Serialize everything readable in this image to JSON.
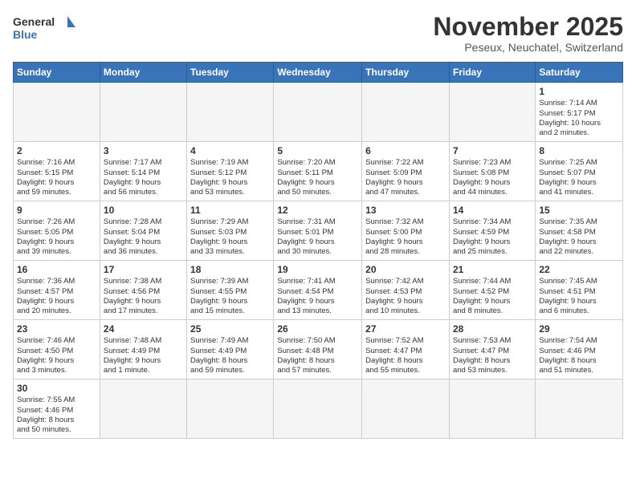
{
  "logo": {
    "text_general": "General",
    "text_blue": "Blue"
  },
  "header": {
    "month_title": "November 2025",
    "subtitle": "Peseux, Neuchatel, Switzerland"
  },
  "weekdays": [
    "Sunday",
    "Monday",
    "Tuesday",
    "Wednesday",
    "Thursday",
    "Friday",
    "Saturday"
  ],
  "weeks": [
    [
      {
        "day": "",
        "info": ""
      },
      {
        "day": "",
        "info": ""
      },
      {
        "day": "",
        "info": ""
      },
      {
        "day": "",
        "info": ""
      },
      {
        "day": "",
        "info": ""
      },
      {
        "day": "",
        "info": ""
      },
      {
        "day": "1",
        "info": "Sunrise: 7:14 AM\nSunset: 5:17 PM\nDaylight: 10 hours\nand 2 minutes."
      }
    ],
    [
      {
        "day": "2",
        "info": "Sunrise: 7:16 AM\nSunset: 5:15 PM\nDaylight: 9 hours\nand 59 minutes."
      },
      {
        "day": "3",
        "info": "Sunrise: 7:17 AM\nSunset: 5:14 PM\nDaylight: 9 hours\nand 56 minutes."
      },
      {
        "day": "4",
        "info": "Sunrise: 7:19 AM\nSunset: 5:12 PM\nDaylight: 9 hours\nand 53 minutes."
      },
      {
        "day": "5",
        "info": "Sunrise: 7:20 AM\nSunset: 5:11 PM\nDaylight: 9 hours\nand 50 minutes."
      },
      {
        "day": "6",
        "info": "Sunrise: 7:22 AM\nSunset: 5:09 PM\nDaylight: 9 hours\nand 47 minutes."
      },
      {
        "day": "7",
        "info": "Sunrise: 7:23 AM\nSunset: 5:08 PM\nDaylight: 9 hours\nand 44 minutes."
      },
      {
        "day": "8",
        "info": "Sunrise: 7:25 AM\nSunset: 5:07 PM\nDaylight: 9 hours\nand 41 minutes."
      }
    ],
    [
      {
        "day": "9",
        "info": "Sunrise: 7:26 AM\nSunset: 5:05 PM\nDaylight: 9 hours\nand 39 minutes."
      },
      {
        "day": "10",
        "info": "Sunrise: 7:28 AM\nSunset: 5:04 PM\nDaylight: 9 hours\nand 36 minutes."
      },
      {
        "day": "11",
        "info": "Sunrise: 7:29 AM\nSunset: 5:03 PM\nDaylight: 9 hours\nand 33 minutes."
      },
      {
        "day": "12",
        "info": "Sunrise: 7:31 AM\nSunset: 5:01 PM\nDaylight: 9 hours\nand 30 minutes."
      },
      {
        "day": "13",
        "info": "Sunrise: 7:32 AM\nSunset: 5:00 PM\nDaylight: 9 hours\nand 28 minutes."
      },
      {
        "day": "14",
        "info": "Sunrise: 7:34 AM\nSunset: 4:59 PM\nDaylight: 9 hours\nand 25 minutes."
      },
      {
        "day": "15",
        "info": "Sunrise: 7:35 AM\nSunset: 4:58 PM\nDaylight: 9 hours\nand 22 minutes."
      }
    ],
    [
      {
        "day": "16",
        "info": "Sunrise: 7:36 AM\nSunset: 4:57 PM\nDaylight: 9 hours\nand 20 minutes."
      },
      {
        "day": "17",
        "info": "Sunrise: 7:38 AM\nSunset: 4:56 PM\nDaylight: 9 hours\nand 17 minutes."
      },
      {
        "day": "18",
        "info": "Sunrise: 7:39 AM\nSunset: 4:55 PM\nDaylight: 9 hours\nand 15 minutes."
      },
      {
        "day": "19",
        "info": "Sunrise: 7:41 AM\nSunset: 4:54 PM\nDaylight: 9 hours\nand 13 minutes."
      },
      {
        "day": "20",
        "info": "Sunrise: 7:42 AM\nSunset: 4:53 PM\nDaylight: 9 hours\nand 10 minutes."
      },
      {
        "day": "21",
        "info": "Sunrise: 7:44 AM\nSunset: 4:52 PM\nDaylight: 9 hours\nand 8 minutes."
      },
      {
        "day": "22",
        "info": "Sunrise: 7:45 AM\nSunset: 4:51 PM\nDaylight: 9 hours\nand 6 minutes."
      }
    ],
    [
      {
        "day": "23",
        "info": "Sunrise: 7:46 AM\nSunset: 4:50 PM\nDaylight: 9 hours\nand 3 minutes."
      },
      {
        "day": "24",
        "info": "Sunrise: 7:48 AM\nSunset: 4:49 PM\nDaylight: 9 hours\nand 1 minute."
      },
      {
        "day": "25",
        "info": "Sunrise: 7:49 AM\nSunset: 4:49 PM\nDaylight: 8 hours\nand 59 minutes."
      },
      {
        "day": "26",
        "info": "Sunrise: 7:50 AM\nSunset: 4:48 PM\nDaylight: 8 hours\nand 57 minutes."
      },
      {
        "day": "27",
        "info": "Sunrise: 7:52 AM\nSunset: 4:47 PM\nDaylight: 8 hours\nand 55 minutes."
      },
      {
        "day": "28",
        "info": "Sunrise: 7:53 AM\nSunset: 4:47 PM\nDaylight: 8 hours\nand 53 minutes."
      },
      {
        "day": "29",
        "info": "Sunrise: 7:54 AM\nSunset: 4:46 PM\nDaylight: 8 hours\nand 51 minutes."
      }
    ],
    [
      {
        "day": "30",
        "info": "Sunrise: 7:55 AM\nSunset: 4:46 PM\nDaylight: 8 hours\nand 50 minutes."
      },
      {
        "day": "",
        "info": ""
      },
      {
        "day": "",
        "info": ""
      },
      {
        "day": "",
        "info": ""
      },
      {
        "day": "",
        "info": ""
      },
      {
        "day": "",
        "info": ""
      },
      {
        "day": "",
        "info": ""
      }
    ]
  ]
}
